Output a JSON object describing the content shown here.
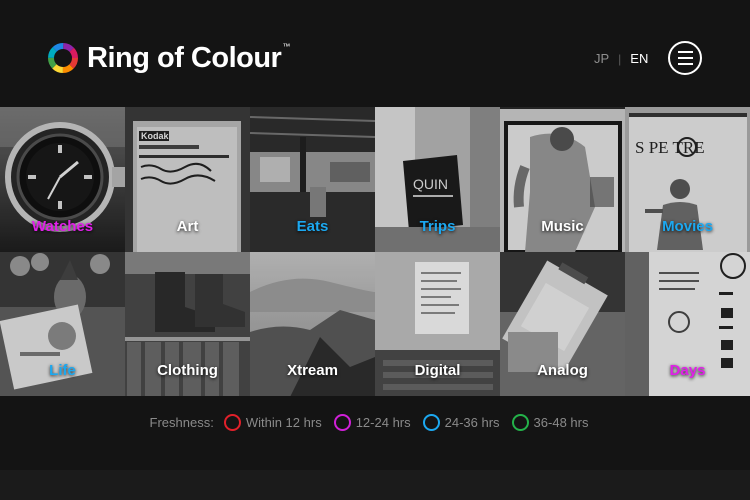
{
  "header": {
    "brand": "Ring of Colour",
    "trademark": "™",
    "lang_jp": "JP",
    "lang_separator": "|",
    "lang_en": "EN",
    "menu_icon": "hamburger-menu-icon"
  },
  "tiles": [
    {
      "label": "Watches",
      "color": "#e020e8"
    },
    {
      "label": "Art",
      "color": "#ffffff"
    },
    {
      "label": "Eats",
      "color": "#1ca8f0"
    },
    {
      "label": "Trips",
      "color": "#1ca8f0"
    },
    {
      "label": "Music",
      "color": "#ffffff"
    },
    {
      "label": "Movies",
      "color": "#1ca8f0"
    },
    {
      "label": "Life",
      "color": "#1ca8f0"
    },
    {
      "label": "Clothing",
      "color": "#ffffff"
    },
    {
      "label": "Xtream",
      "color": "#ffffff"
    },
    {
      "label": "Digital",
      "color": "#ffffff"
    },
    {
      "label": "Analog",
      "color": "#ffffff"
    },
    {
      "label": "Days",
      "color": "#e020e8"
    }
  ],
  "legend": {
    "title": "Freshness:",
    "items": [
      {
        "label": "Within 12 hrs",
        "color": "#e0202a"
      },
      {
        "label": "12-24 hrs",
        "color": "#d020d8"
      },
      {
        "label": "24-36 hrs",
        "color": "#1ca8f0"
      },
      {
        "label": "36-48 hrs",
        "color": "#24b24a"
      }
    ]
  }
}
